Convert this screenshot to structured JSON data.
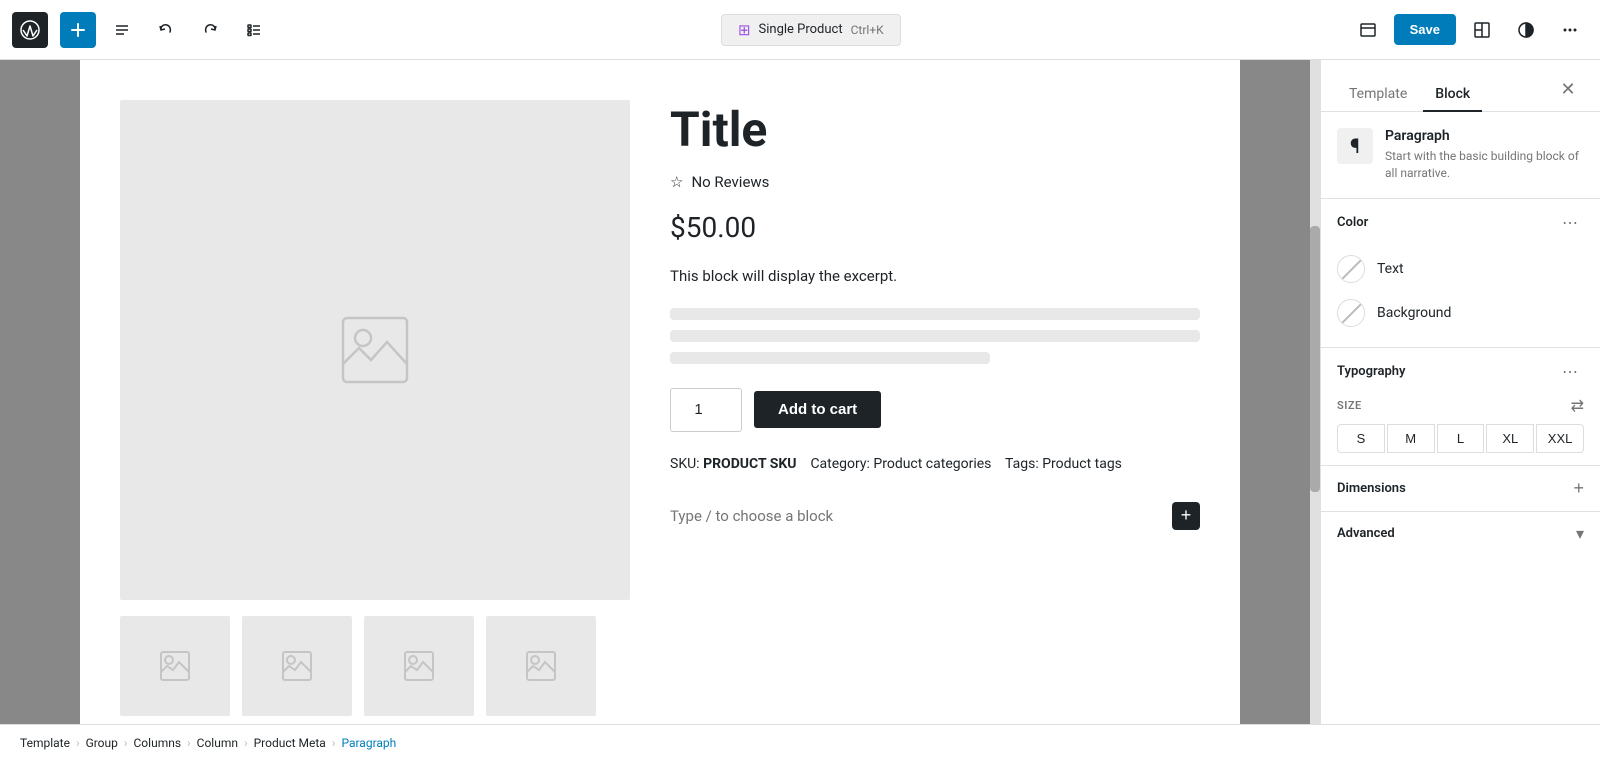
{
  "toolbar": {
    "logo_text": "W",
    "add_label": "+",
    "undo_label": "↩",
    "redo_label": "↪",
    "list_label": "≡",
    "template_badge": {
      "icon": "⊞",
      "name": "Single Product",
      "shortcut": "Ctrl+K"
    },
    "view_icon": "⊡",
    "save_label": "Save",
    "layout_icon": "⊟",
    "contrast_icon": "◑",
    "more_icon": "⋯"
  },
  "canvas": {
    "product": {
      "title": "Title",
      "reviews": "No Reviews",
      "price": "$50.00",
      "excerpt": "This block will display the excerpt.",
      "quantity": "1",
      "add_to_cart": "Add to cart",
      "sku_label": "SKU:",
      "sku_value": "PRODUCT SKU",
      "category_label": "Category:",
      "category_value": "Product categories",
      "tags_label": "Tags:",
      "tags_value": "Product tags"
    },
    "block_hint": "Type / to choose a block"
  },
  "breadcrumb": {
    "items": [
      {
        "label": "Template",
        "active": false
      },
      {
        "label": "Group",
        "active": false
      },
      {
        "label": "Columns",
        "active": false
      },
      {
        "label": "Column",
        "active": false
      },
      {
        "label": "Product Meta",
        "active": false
      },
      {
        "label": "Paragraph",
        "active": true
      }
    ]
  },
  "right_panel": {
    "tabs": [
      {
        "label": "Template",
        "active": false
      },
      {
        "label": "Block",
        "active": true
      }
    ],
    "block_info": {
      "icon": "¶",
      "name": "Paragraph",
      "description": "Start with the basic building block of all narrative."
    },
    "color_section": {
      "title": "Color",
      "menu_icon": "⋯",
      "options": [
        {
          "label": "Text",
          "has_color": false
        },
        {
          "label": "Background",
          "has_color": false
        }
      ]
    },
    "typography_section": {
      "title": "Typography",
      "menu_icon": "⋯",
      "size_label": "SIZE",
      "sizes": [
        "S",
        "M",
        "L",
        "XL",
        "XXL"
      ]
    },
    "dimensions_section": {
      "title": "Dimensions",
      "expand_icon": "+"
    },
    "advanced_section": {
      "title": "Advanced",
      "chevron_icon": "▾"
    }
  }
}
